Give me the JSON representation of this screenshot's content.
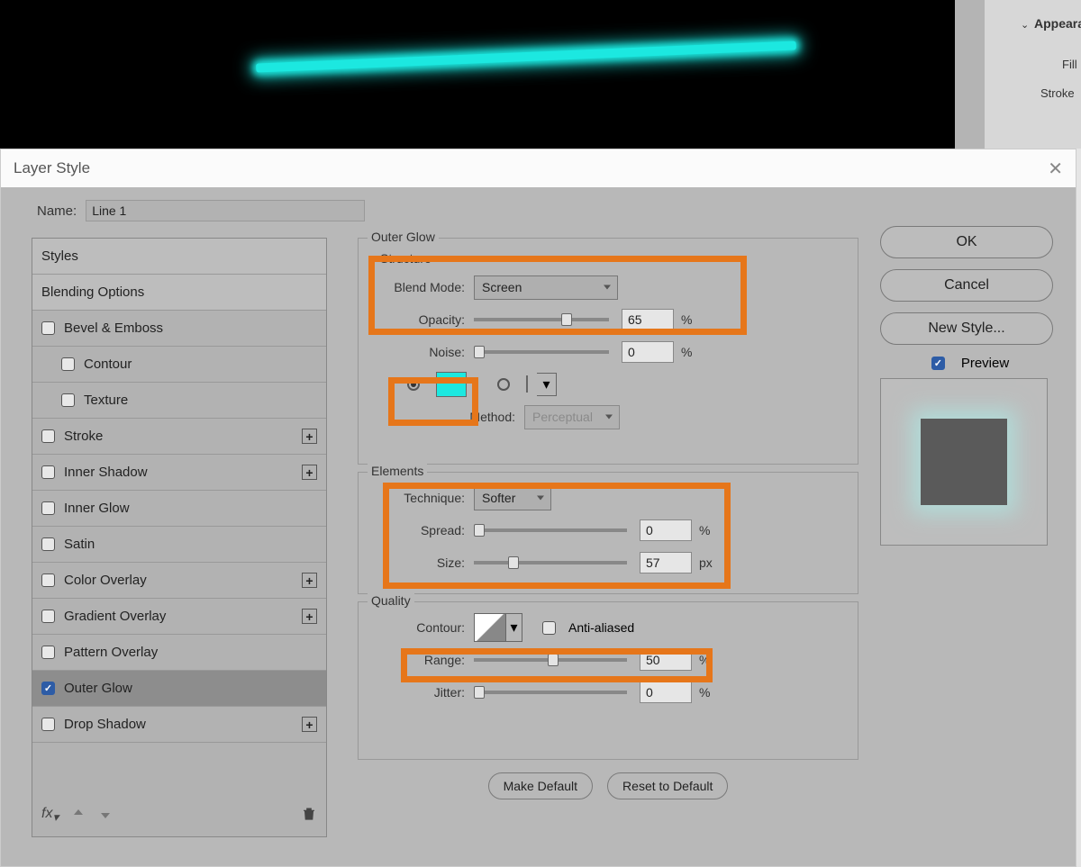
{
  "canvas": {
    "line_color": "#1ce8e0"
  },
  "right_panel": {
    "header": "Appeara",
    "fill_label": "Fill",
    "stroke_label": "Stroke"
  },
  "dialog": {
    "title": "Layer Style",
    "name_label": "Name:",
    "name_value": "Line 1",
    "styles": {
      "header": "Styles",
      "blending": "Blending Options",
      "items": [
        {
          "label": "Bevel & Emboss",
          "checked": false,
          "add": false
        },
        {
          "label": "Contour",
          "checked": false,
          "add": false,
          "indent": true
        },
        {
          "label": "Texture",
          "checked": false,
          "add": false,
          "indent": true
        },
        {
          "label": "Stroke",
          "checked": false,
          "add": true
        },
        {
          "label": "Inner Shadow",
          "checked": false,
          "add": true
        },
        {
          "label": "Inner Glow",
          "checked": false,
          "add": false
        },
        {
          "label": "Satin",
          "checked": false,
          "add": false
        },
        {
          "label": "Color Overlay",
          "checked": false,
          "add": true
        },
        {
          "label": "Gradient Overlay",
          "checked": false,
          "add": true
        },
        {
          "label": "Pattern Overlay",
          "checked": false,
          "add": false
        },
        {
          "label": "Outer Glow",
          "checked": true,
          "selected": true,
          "add": false
        },
        {
          "label": "Drop Shadow",
          "checked": false,
          "add": true
        }
      ],
      "fx_label": "fx"
    },
    "settings": {
      "group_title": "Outer Glow",
      "structure_title": "Structure",
      "blend_mode_label": "Blend Mode:",
      "blend_mode_value": "Screen",
      "opacity_label": "Opacity:",
      "opacity_value": "65",
      "percent_unit": "%",
      "noise_label": "Noise:",
      "noise_value": "0",
      "color_swatch": "#1ce8e0",
      "method_label": "Method:",
      "method_value": "Perceptual",
      "elements_title": "Elements",
      "technique_label": "Technique:",
      "technique_value": "Softer",
      "spread_label": "Spread:",
      "spread_value": "0",
      "size_label": "Size:",
      "size_value": "57",
      "px_unit": "px",
      "quality_title": "Quality",
      "contour_label": "Contour:",
      "antialiased_label": "Anti-aliased",
      "range_label": "Range:",
      "range_value": "50",
      "jitter_label": "Jitter:",
      "jitter_value": "0",
      "make_default": "Make Default",
      "reset_default": "Reset to Default"
    },
    "actions": {
      "ok": "OK",
      "cancel": "Cancel",
      "new_style": "New Style...",
      "preview": "Preview"
    }
  }
}
